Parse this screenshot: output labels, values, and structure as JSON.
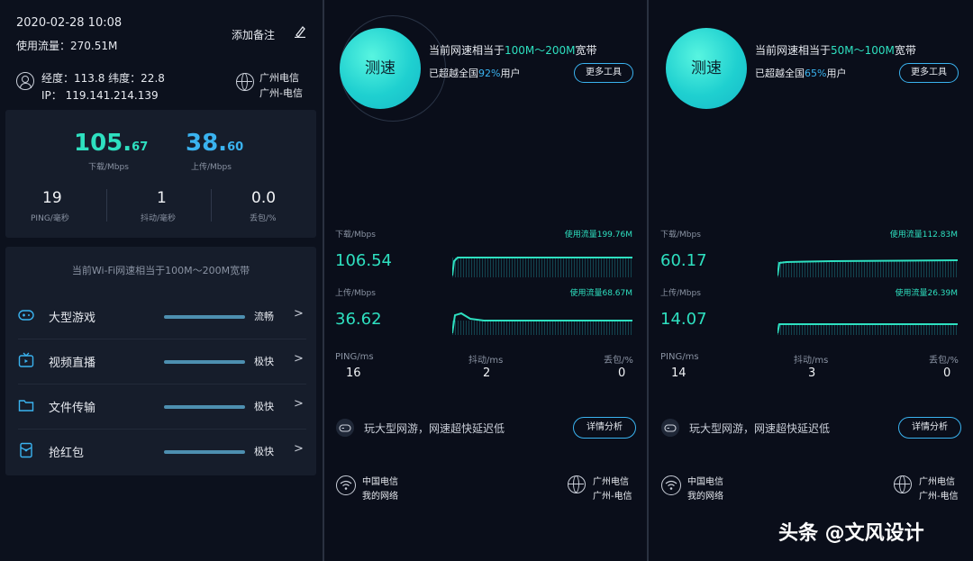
{
  "left": {
    "datetime": "2020-02-28  10:08",
    "usage": "使用流量：270.51M",
    "note_label": "添加备注",
    "coords": "经度：113.8  纬度：22.8",
    "ip": "IP：  119.141.214.139",
    "isp_line1": "广州电信",
    "isp_line2": "广州-电信",
    "download": {
      "int": "105.",
      "dec": "67",
      "caption": "下载/Mbps"
    },
    "upload": {
      "int": "38.",
      "dec": "60",
      "caption": "上传/Mbps"
    },
    "ping": {
      "value": "19",
      "caption": "PING/毫秒"
    },
    "jitter": {
      "value": "1",
      "caption": "抖动/毫秒"
    },
    "loss": {
      "value": "0.0",
      "caption": "丢包/%"
    },
    "wifi_title": "当前Wi-Fi网速相当于100M～200M宽带",
    "rows": [
      {
        "label": "大型游戏",
        "level": "流畅",
        "icon": "gamepad-icon"
      },
      {
        "label": "视频直播",
        "level": "极快",
        "icon": "tv-icon"
      },
      {
        "label": "文件传输",
        "level": "极快",
        "icon": "folder-icon"
      },
      {
        "label": "抢红包",
        "level": "极快",
        "icon": "red-packet-icon"
      }
    ]
  },
  "tests": [
    {
      "orb_label": "测速",
      "head_pre": "当前网速相当于",
      "head_hl": "100M～200M",
      "head_post": "宽带",
      "beat_pre": "已超越全国",
      "beat_hl": "92%",
      "beat_post": "用户",
      "tools_label": "更多工具",
      "dl_label": "下载/Mbps",
      "dl_usage": "使用流量199.76M",
      "dl_value": "106.54",
      "ul_label": "上传/Mbps",
      "ul_usage": "使用流量68.67M",
      "ul_value": "36.62",
      "ping_label": "PING/ms",
      "ping_value": "16",
      "jitter_label": "抖动/ms",
      "jitter_value": "2",
      "loss_label": "丢包/%",
      "loss_value": "0",
      "game_text": "玩大型网游，网速超快延迟低",
      "detail_label": "详情分析",
      "isp_a1": "中国电信",
      "isp_a2": "我的网络",
      "isp_b1": "广州电信",
      "isp_b2": "广州-电信"
    },
    {
      "orb_label": "测速",
      "head_pre": "当前网速相当于",
      "head_hl": "50M～100M",
      "head_post": "宽带",
      "beat_pre": "已超越全国",
      "beat_hl": "65%",
      "beat_post": "用户",
      "tools_label": "更多工具",
      "dl_label": "下载/Mbps",
      "dl_usage": "使用流量112.83M",
      "dl_value": "60.17",
      "ul_label": "上传/Mbps",
      "ul_usage": "使用流量26.39M",
      "ul_value": "14.07",
      "ping_label": "PING/ms",
      "ping_value": "14",
      "jitter_label": "抖动/ms",
      "jitter_value": "3",
      "loss_label": "丢包/%",
      "loss_value": "0",
      "game_text": "玩大型网游，网速超快延迟低",
      "detail_label": "详情分析",
      "isp_a1": "中国电信",
      "isp_a2": "我的网络",
      "isp_b1": "广州电信",
      "isp_b2": "广州-电信"
    }
  ],
  "watermark": "头条 @文风设计",
  "colors": {
    "accent_green": "#2ee0c0",
    "accent_blue": "#3ab3f0",
    "bar": "#4d8fb0"
  }
}
